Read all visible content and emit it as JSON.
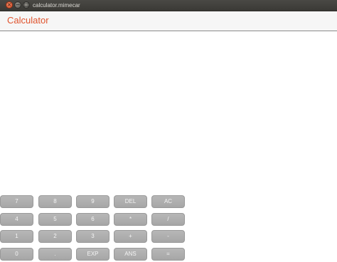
{
  "window": {
    "title": "calculator.mimecar",
    "controls": {
      "close": "×",
      "minimize": "−",
      "maximize": "□"
    }
  },
  "header": {
    "title": "Calculator",
    "title_color": "#e0542e"
  },
  "display": {
    "value": ""
  },
  "keypad": {
    "rows": [
      [
        "7",
        "8",
        "9",
        "DEL",
        "AC"
      ],
      [
        "4",
        "5",
        "6",
        "*",
        "/"
      ],
      [
        "1",
        "2",
        "3",
        "+",
        "-"
      ],
      [
        "0",
        ".",
        "EXP",
        "ANS",
        "="
      ]
    ]
  }
}
